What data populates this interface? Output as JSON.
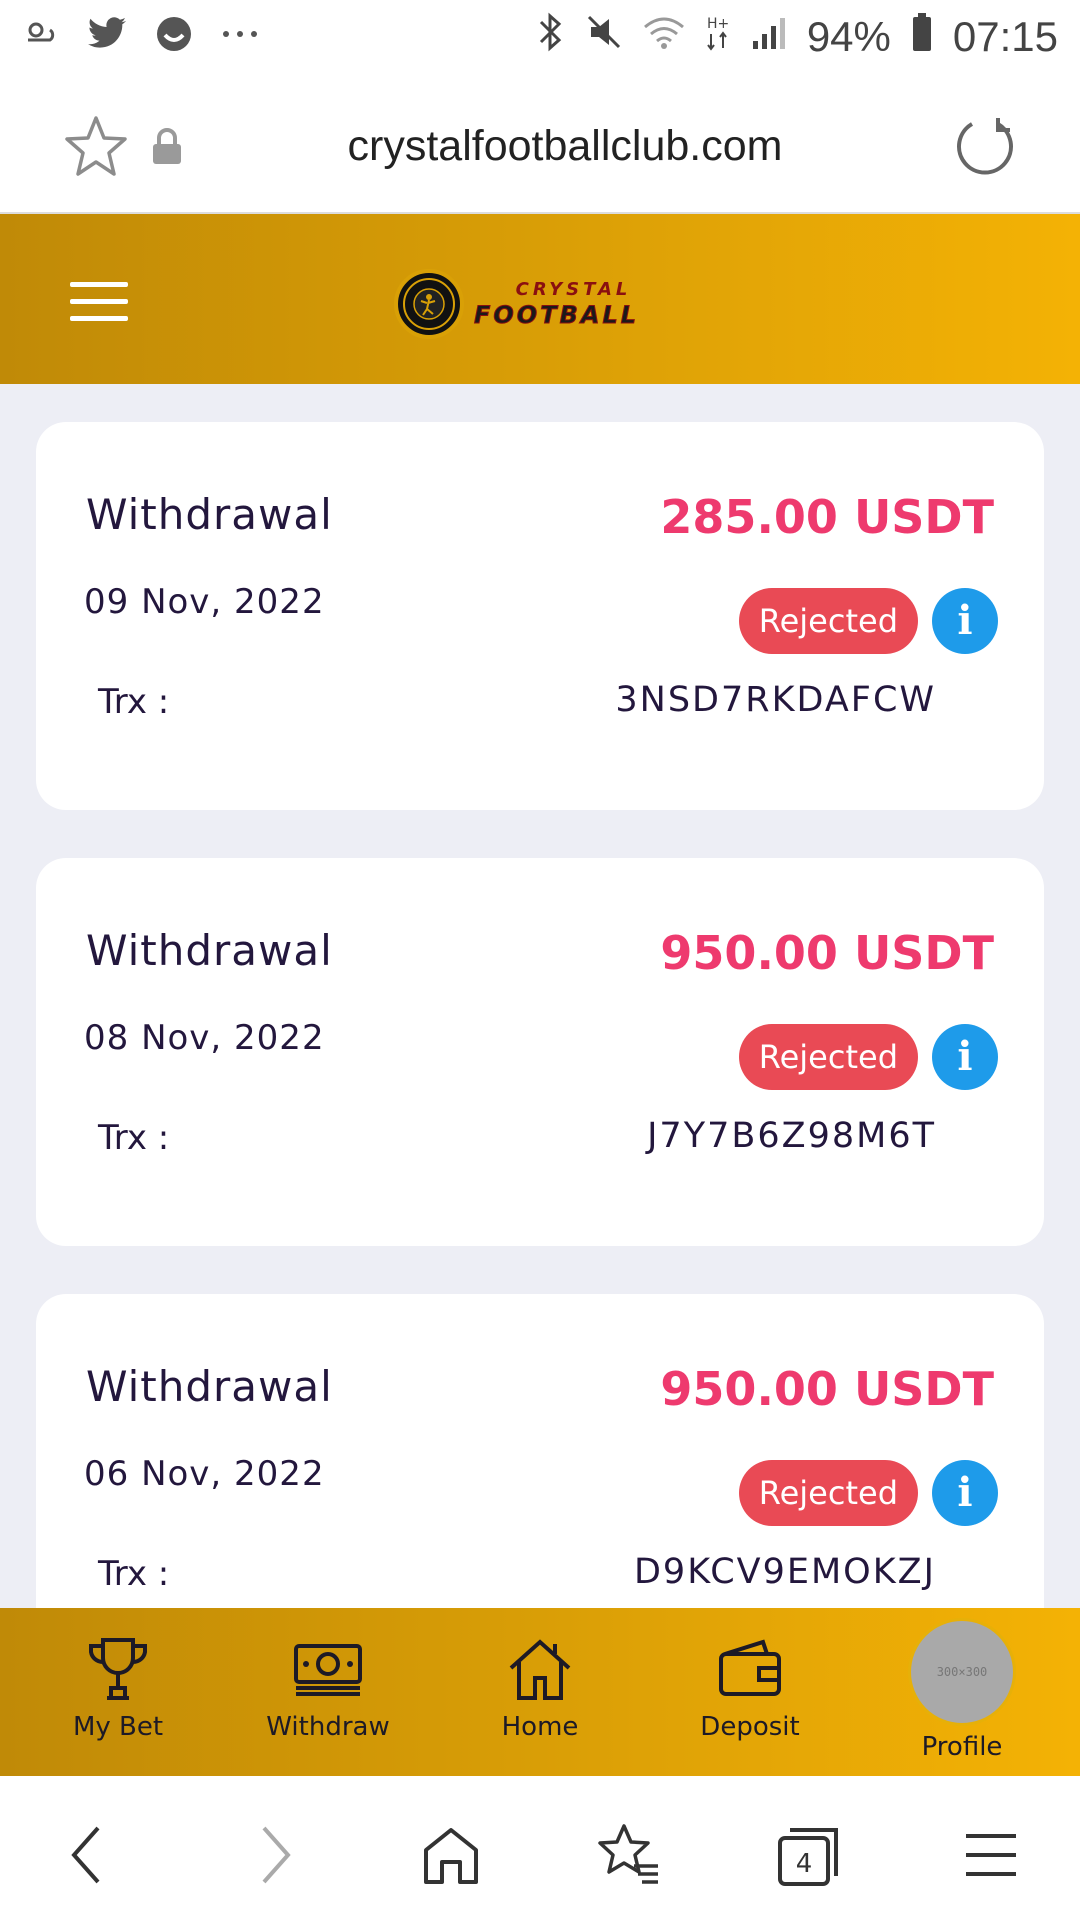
{
  "status_bar": {
    "left_icons": [
      "weather-icon",
      "twitter-icon",
      "messenger-icon",
      "more-dots-icon"
    ],
    "battery": "94%",
    "time": "07:15"
  },
  "browser": {
    "url": "crystalfootballclub.com"
  },
  "header": {
    "logo_line1": "CRYSTAL",
    "logo_line2": "FOOTBALL",
    "logo_badge_text": "CRYSTAL FOOTBALL"
  },
  "transactions": [
    {
      "type": "Withdrawal",
      "date": "09 Nov, 2022",
      "amount": "285.00 USDT",
      "status": "Rejected",
      "trx_label": "Trx :",
      "trx_id": "3NSD7RKDAFCW"
    },
    {
      "type": "Withdrawal",
      "date": "08 Nov, 2022",
      "amount": "950.00 USDT",
      "status": "Rejected",
      "trx_label": "Trx :",
      "trx_id": "J7Y7B6Z98M6T"
    },
    {
      "type": "Withdrawal",
      "date": "06 Nov, 2022",
      "amount": "950.00 USDT",
      "status": "Rejected",
      "trx_label": "Trx :",
      "trx_id": "D9KCV9EMOKZJ"
    }
  ],
  "app_nav": {
    "items": [
      {
        "label": "My Bet",
        "icon": "trophy-icon"
      },
      {
        "label": "Withdraw",
        "icon": "money-icon"
      },
      {
        "label": "Home",
        "icon": "home-icon"
      },
      {
        "label": "Deposit",
        "icon": "wallet-icon"
      },
      {
        "label": "Profile",
        "icon": "avatar"
      }
    ],
    "avatar_placeholder": "300×300"
  },
  "browser_nav": {
    "tab_count": "4"
  },
  "colors": {
    "header_gradient_start": "#c08a07",
    "header_gradient_end": "#f4b205",
    "amount": "#ee3a6e",
    "rejected_badge": "#e94a55",
    "info_button": "#1e9bea",
    "text_dark": "#23173d",
    "background": "#edeef5"
  }
}
